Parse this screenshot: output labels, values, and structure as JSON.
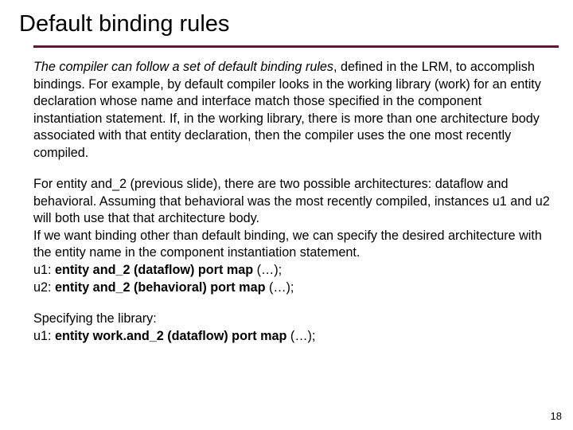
{
  "title": "Default binding rules",
  "para1": {
    "lead_italic": "The compiler can follow a set of default binding rules",
    "rest": ", defined in the LRM, to accomplish bindings.  For example, by default compiler looks in the working library (work) for an entity declaration whose name and interface match those specified in the component  instantiation statement. If, in the working library, there is more than one architecture body associated with that entity declaration, then the compiler uses the one most recently compiled."
  },
  "para2": {
    "l1": "For entity and_2 (previous slide), there are two possible architectures: dataflow and behavioral. Assuming that behavioral was the most recently compiled, instances u1 and u2 will both use that that architecture body.",
    "l2": "If we want binding other than default binding, we can specify the desired architecture with the entity name in the component instantiation statement.",
    "u1_pre": "u1: ",
    "u1_bold": "entity and_2 (dataflow) port map",
    "u1_post": " (…);",
    "u2_pre": "u2: ",
    "u2_bold": "entity and_2 (behavioral) port map",
    "u2_post": " (…);"
  },
  "para3": {
    "l1": "Specifying the library:",
    "u1_pre": " u1: ",
    "u1_bold": "entity work.and_2 (dataflow) port map",
    "u1_post": " (…);"
  },
  "page_number": "18"
}
